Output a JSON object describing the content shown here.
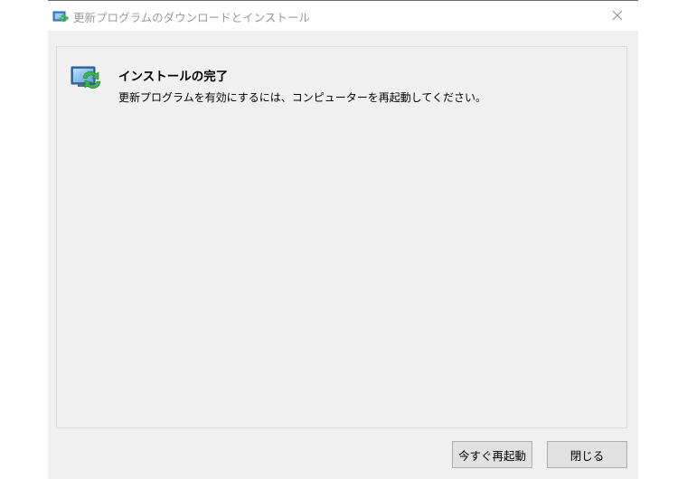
{
  "window": {
    "title": "更新プログラムのダウンロードとインストール"
  },
  "content": {
    "heading": "インストールの完了",
    "message": "更新プログラムを有効にするには、コンピューターを再起動してください。"
  },
  "buttons": {
    "restart_now": "今すぐ再起動",
    "close": "閉じる"
  },
  "icons": {
    "title": "windows-update-icon",
    "status": "windows-update-icon",
    "close": "close-icon"
  },
  "colors": {
    "window_background": "#f0f0f0",
    "titlebar_background": "#ffffff",
    "title_text": "#999999",
    "button_background": "#e1e1e1",
    "button_border": "#adadad",
    "update_green": "#3bb54a",
    "monitor_blue": "#4a8fd8"
  }
}
